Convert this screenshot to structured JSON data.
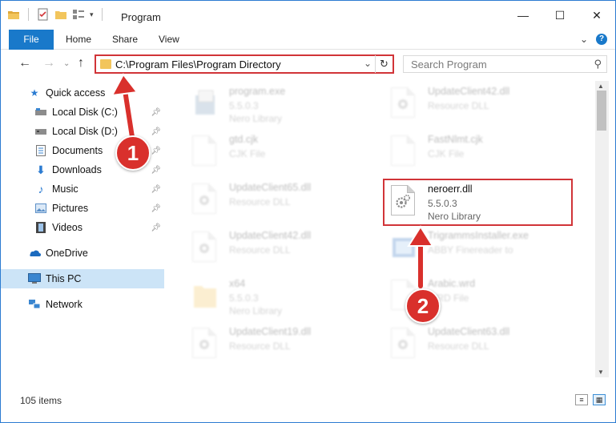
{
  "window": {
    "title": "Program",
    "controls": {
      "minimize": "—",
      "maximize": "☐",
      "close": "✕"
    }
  },
  "ribbon": {
    "tabs": [
      "File",
      "Home",
      "Share",
      "View"
    ],
    "chevron": "⌄",
    "help": "?"
  },
  "nav": {
    "back": "←",
    "forward": "→",
    "recent": "⌄",
    "up": "↑",
    "address": "C:\\Program Files\\Program Directory",
    "address_chevron": "⌄",
    "refresh": "↻",
    "search_placeholder": "Search Program",
    "search_icon": "⚲"
  },
  "sidebar": {
    "items": [
      {
        "label": "Quick access",
        "icon": "star-icon",
        "pinned": false
      },
      {
        "label": "Local Disk (C:)",
        "icon": "drive-icon",
        "pinned": true
      },
      {
        "label": "Local Disk (D:)",
        "icon": "drive-icon",
        "pinned": true
      },
      {
        "label": "Documents",
        "icon": "documents-icon",
        "pinned": true
      },
      {
        "label": "Downloads",
        "icon": "downloads-icon",
        "pinned": true
      },
      {
        "label": "Music",
        "icon": "music-icon",
        "pinned": true
      },
      {
        "label": "Pictures",
        "icon": "pictures-icon",
        "pinned": true
      },
      {
        "label": "Videos",
        "icon": "videos-icon",
        "pinned": true
      },
      {
        "label": "OneDrive",
        "icon": "onedrive-icon",
        "pinned": false
      },
      {
        "label": "This PC",
        "icon": "pc-icon",
        "pinned": false,
        "selected": true
      },
      {
        "label": "Network",
        "icon": "network-icon",
        "pinned": false
      }
    ]
  },
  "files": [
    {
      "name": "program.exe",
      "version": "5.5.0.3",
      "type": "Nero Library",
      "icon": "exe-icon",
      "faded": true
    },
    {
      "name": "UpdateClient42.dll",
      "version": "",
      "type": "Resource DLL",
      "icon": "dll-icon",
      "faded": true
    },
    {
      "name": "gtd.cjk",
      "version": "",
      "type": "CJK File",
      "icon": "file-icon",
      "faded": true
    },
    {
      "name": "FastNlmt.cjk",
      "version": "",
      "type": "CJK File",
      "icon": "file-icon",
      "faded": true
    },
    {
      "name": "UpdateClient65.dll",
      "version": "",
      "type": "Resource DLL",
      "icon": "dll-icon",
      "faded": true
    },
    {
      "name": "neroerr.dll",
      "version": "5.5.0.3",
      "type": "Nero Library",
      "icon": "dll-icon",
      "faded": false
    },
    {
      "name": "UpdateClient42.dll",
      "version": "",
      "type": "Resource DLL",
      "icon": "dll-icon",
      "faded": true
    },
    {
      "name": "TrigrammsInstaller.exe",
      "version": "",
      "type": "ABBY Finereader to",
      "icon": "installer-icon",
      "faded": true
    },
    {
      "name": "x64",
      "version": "5.5.0.3",
      "type": "Nero Library",
      "icon": "folder-icon",
      "faded": true
    },
    {
      "name": "Arabic.wrd",
      "version": "",
      "type": "WRD File",
      "icon": "file-icon",
      "faded": true
    },
    {
      "name": "UpdateClient19.dll",
      "version": "",
      "type": "Resource DLL",
      "icon": "dll-icon",
      "faded": true
    },
    {
      "name": "UpdateClient63.dll",
      "version": "",
      "type": "Resource DLL",
      "icon": "dll-icon",
      "faded": true
    }
  ],
  "status": {
    "item_count": "105 items",
    "details_view": "≡",
    "icons_view": "▦"
  },
  "annotations": [
    {
      "label": "1"
    },
    {
      "label": "2"
    }
  ],
  "colors": {
    "accent": "#1979ca",
    "highlight": "#d13438",
    "marker": "#d9302c",
    "selected": "#cce4f7"
  }
}
